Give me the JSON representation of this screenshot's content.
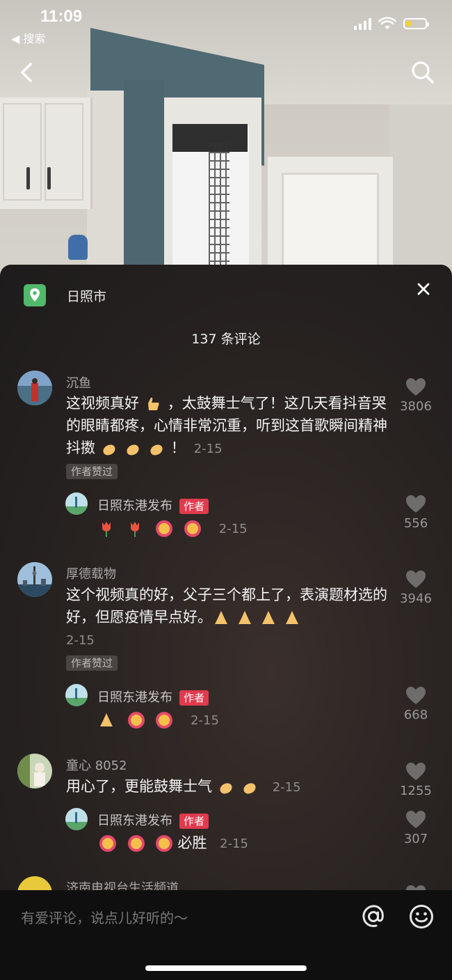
{
  "status_bar": {
    "time": "11:09",
    "back_app": "◀ 搜索",
    "battery_level": 0.25
  },
  "location": {
    "label": "日照市"
  },
  "comments_header": {
    "count_label": "137 条评论"
  },
  "comments": [
    {
      "user": "沉鱼",
      "text": "这视频真好 👍，太鼓舞士气了！这几天看抖音哭的眼睛都疼，心情非常沉重，听到这首歌瞬间精神抖擞 👏👏👏！",
      "date": "2-15",
      "badge": "作者赞过",
      "likes": "3806",
      "reply": {
        "user": "日照东港发布",
        "tag": "作者",
        "text": "🌷 🌷 加油 加油",
        "date": "2-15",
        "likes": "556"
      }
    },
    {
      "user": "厚德载物",
      "text": "这个视频真的好，父子三个都上了，表演题材选的好，但愿疫情早点好。🙏🙏🙏🙏",
      "date": "2-15",
      "badge": "作者赞过",
      "likes": "3946",
      "reply": {
        "user": "日照东港发布",
        "tag": "作者",
        "text": "🙏 加油 加油",
        "date": "2-15",
        "likes": "668"
      }
    },
    {
      "user": "童心 8052",
      "text": "用心了，更能鼓舞士气 👏👏",
      "date": "2-15",
      "likes": "1255",
      "reply": {
        "user": "日照东港发布",
        "tag": "作者",
        "text": "必胜",
        "date": "2-15",
        "likes": "307"
      }
    },
    {
      "user": "济南电视台生活频道"
    }
  ],
  "input": {
    "placeholder": "有爱评论，说点儿好听的～"
  },
  "icons": {
    "back": "chevron-left-icon",
    "search": "search-icon",
    "location": "map-pin-icon",
    "close": "close-icon",
    "like": "heart-icon",
    "mention": "at-icon",
    "emoji": "smiley-icon"
  },
  "colors": {
    "location_green": "#52b86b",
    "author_tag_red": "#e03a4d",
    "battery_yellow": "#f6d22c"
  }
}
